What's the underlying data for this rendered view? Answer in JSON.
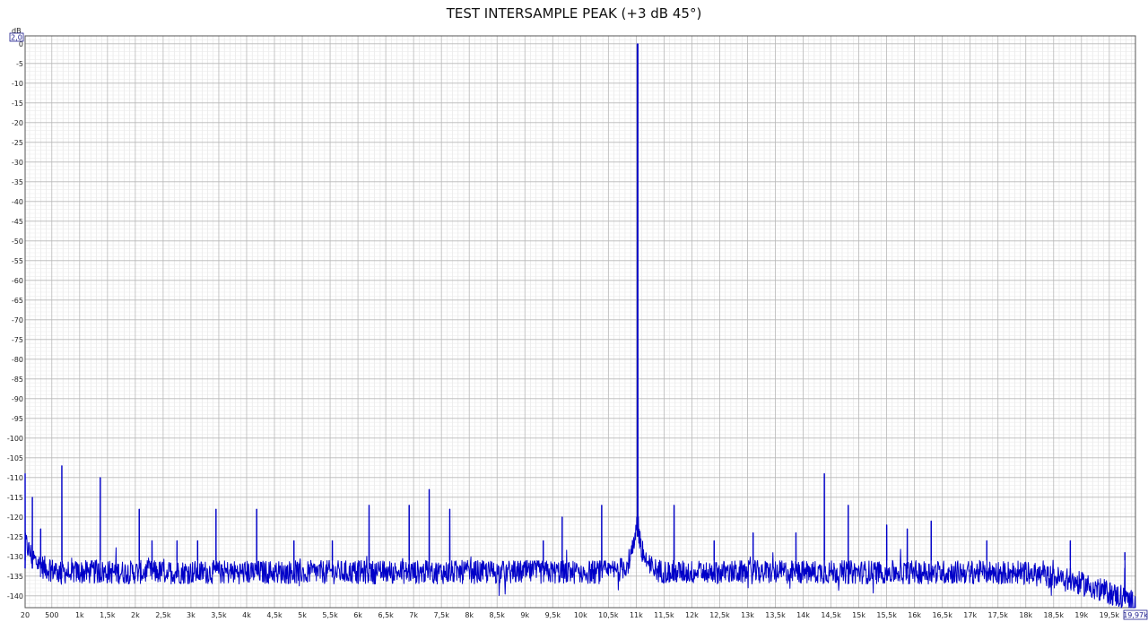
{
  "chart_data": {
    "type": "line",
    "title": "TEST INTERSAMPLE PEAK (+3 dB 45°)",
    "y_unit": "dB",
    "y_top_label": "2,0",
    "x_end_label": "19,97k",
    "xlim": [
      20,
      19970
    ],
    "ylim": [
      -143,
      2
    ],
    "grid": true,
    "series_color": "#0000c8",
    "y_ticks": [
      {
        "v": 0,
        "label": "0"
      },
      {
        "v": -5,
        "label": "-5"
      },
      {
        "v": -10,
        "label": "-10"
      },
      {
        "v": -15,
        "label": "-15"
      },
      {
        "v": -20,
        "label": "-20"
      },
      {
        "v": -25,
        "label": "-25"
      },
      {
        "v": -30,
        "label": "-30"
      },
      {
        "v": -35,
        "label": "-35"
      },
      {
        "v": -40,
        "label": "-40"
      },
      {
        "v": -45,
        "label": "-45"
      },
      {
        "v": -50,
        "label": "-50"
      },
      {
        "v": -55,
        "label": "-55"
      },
      {
        "v": -60,
        "label": "-60"
      },
      {
        "v": -65,
        "label": "-65"
      },
      {
        "v": -70,
        "label": "-70"
      },
      {
        "v": -75,
        "label": "-75"
      },
      {
        "v": -80,
        "label": "-80"
      },
      {
        "v": -85,
        "label": "-85"
      },
      {
        "v": -90,
        "label": "-90"
      },
      {
        "v": -95,
        "label": "-95"
      },
      {
        "v": -100,
        "label": "-100"
      },
      {
        "v": -105,
        "label": "-105"
      },
      {
        "v": -110,
        "label": "-110"
      },
      {
        "v": -115,
        "label": "-115"
      },
      {
        "v": -120,
        "label": "-120"
      },
      {
        "v": -125,
        "label": "-125"
      },
      {
        "v": -130,
        "label": "-130"
      },
      {
        "v": -135,
        "label": "-135"
      },
      {
        "v": -140,
        "label": "-140"
      }
    ],
    "x_ticks": [
      {
        "v": 20,
        "label": "20"
      },
      {
        "v": 500,
        "label": "500"
      },
      {
        "v": 1000,
        "label": "1k"
      },
      {
        "v": 1500,
        "label": "1,5k"
      },
      {
        "v": 2000,
        "label": "2k"
      },
      {
        "v": 2500,
        "label": "2,5k"
      },
      {
        "v": 3000,
        "label": "3k"
      },
      {
        "v": 3500,
        "label": "3,5k"
      },
      {
        "v": 4000,
        "label": "4k"
      },
      {
        "v": 4500,
        "label": "4,5k"
      },
      {
        "v": 5000,
        "label": "5k"
      },
      {
        "v": 5500,
        "label": "5,5k"
      },
      {
        "v": 6000,
        "label": "6k"
      },
      {
        "v": 6500,
        "label": "6,5k"
      },
      {
        "v": 7000,
        "label": "7k"
      },
      {
        "v": 7500,
        "label": "7,5k"
      },
      {
        "v": 8000,
        "label": "8k"
      },
      {
        "v": 8500,
        "label": "8,5k"
      },
      {
        "v": 9000,
        "label": "9k"
      },
      {
        "v": 9500,
        "label": "9,5k"
      },
      {
        "v": 10000,
        "label": "10k"
      },
      {
        "v": 10500,
        "label": "10,5k"
      },
      {
        "v": 11000,
        "label": "11k"
      },
      {
        "v": 11500,
        "label": "11,5k"
      },
      {
        "v": 12000,
        "label": "12k"
      },
      {
        "v": 12500,
        "label": "12,5k"
      },
      {
        "v": 13000,
        "label": "13k"
      },
      {
        "v": 13500,
        "label": "13,5k"
      },
      {
        "v": 14000,
        "label": "14k"
      },
      {
        "v": 14500,
        "label": "14,5k"
      },
      {
        "v": 15000,
        "label": "15k"
      },
      {
        "v": 15500,
        "label": "15,5k"
      },
      {
        "v": 16000,
        "label": "16k"
      },
      {
        "v": 16500,
        "label": "16,5k"
      },
      {
        "v": 17000,
        "label": "17k"
      },
      {
        "v": 17500,
        "label": "17,5k"
      },
      {
        "v": 18000,
        "label": "18k"
      },
      {
        "v": 18500,
        "label": "18,5k"
      },
      {
        "v": 19000,
        "label": "19k"
      },
      {
        "v": 19500,
        "label": "19,5k"
      }
    ],
    "noise_floor_db": -134,
    "main_peak": {
      "x": 11025,
      "y": 0
    },
    "spurs": [
      {
        "x": 20,
        "y": -109
      },
      {
        "x": 150,
        "y": -115
      },
      {
        "x": 300,
        "y": -123
      },
      {
        "x": 680,
        "y": -107
      },
      {
        "x": 1370,
        "y": -110
      },
      {
        "x": 2070,
        "y": -118
      },
      {
        "x": 2300,
        "y": -126
      },
      {
        "x": 2750,
        "y": -126
      },
      {
        "x": 3120,
        "y": -126
      },
      {
        "x": 3450,
        "y": -118
      },
      {
        "x": 4180,
        "y": -118
      },
      {
        "x": 4850,
        "y": -126
      },
      {
        "x": 5540,
        "y": -126
      },
      {
        "x": 6200,
        "y": -117
      },
      {
        "x": 6920,
        "y": -117
      },
      {
        "x": 7280,
        "y": -113
      },
      {
        "x": 7650,
        "y": -118
      },
      {
        "x": 9330,
        "y": -126
      },
      {
        "x": 9670,
        "y": -120
      },
      {
        "x": 10380,
        "y": -117
      },
      {
        "x": 11680,
        "y": -117
      },
      {
        "x": 12400,
        "y": -126
      },
      {
        "x": 13100,
        "y": -124
      },
      {
        "x": 13870,
        "y": -124
      },
      {
        "x": 14380,
        "y": -109
      },
      {
        "x": 14810,
        "y": -117
      },
      {
        "x": 15500,
        "y": -122
      },
      {
        "x": 15870,
        "y": -123
      },
      {
        "x": 16300,
        "y": -121
      },
      {
        "x": 17300,
        "y": -126
      },
      {
        "x": 18800,
        "y": -126
      },
      {
        "x": 19780,
        "y": -129
      }
    ]
  }
}
